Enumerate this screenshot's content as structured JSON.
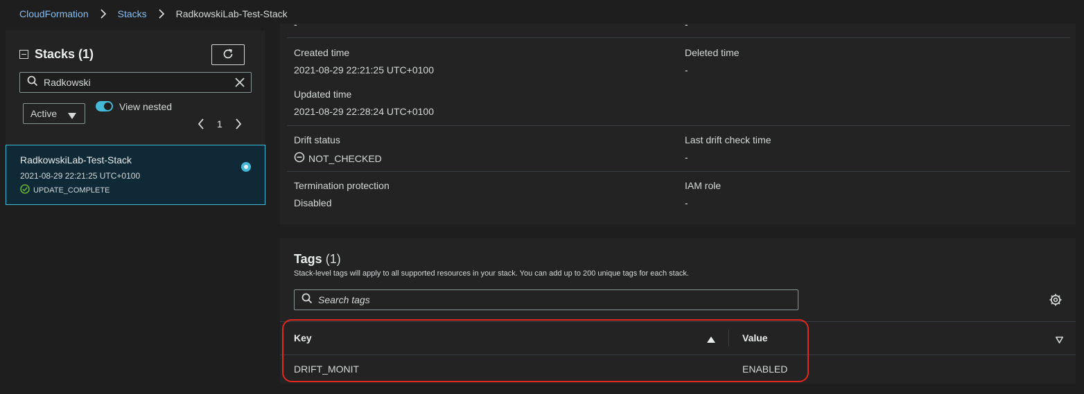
{
  "breadcrumb": {
    "items": [
      "CloudFormation",
      "Stacks"
    ],
    "current": "RadkowskiLab-Test-Stack"
  },
  "sidebar": {
    "title": "Stacks (1)",
    "search_value": "Radkowski",
    "status_filter": "Active",
    "view_nested_label": "View nested",
    "view_nested_on": true,
    "page": "1",
    "stack": {
      "name": "RadkowskiLab-Test-Stack",
      "date": "2021-08-29 22:21:25 UTC+0100",
      "status": "UPDATE_COMPLETE"
    }
  },
  "details": {
    "top_left_value": "-",
    "top_right_value": "-",
    "created_label": "Created time",
    "created_value": "2021-08-29 22:21:25 UTC+0100",
    "deleted_label": "Deleted time",
    "deleted_value": "-",
    "updated_label": "Updated time",
    "updated_value": "2021-08-29 22:28:24 UTC+0100",
    "drift_label": "Drift status",
    "drift_value": "NOT_CHECKED",
    "last_drift_label": "Last drift check time",
    "last_drift_value": "-",
    "termination_label": "Termination protection",
    "termination_value": "Disabled",
    "iam_label": "IAM role",
    "iam_value": "-"
  },
  "tags": {
    "title": "Tags",
    "count": "(1)",
    "description": "Stack-level tags will apply to all supported resources in your stack. You can add up to 200 unique tags for each stack.",
    "search_placeholder": "Search tags",
    "columns": {
      "key": "Key",
      "value": "Value"
    },
    "rows": [
      {
        "key": "DRIFT_MONIT",
        "value": "ENABLED"
      }
    ]
  },
  "colors": {
    "link": "#89bdee",
    "accent": "#44b9d6",
    "success": "#6aaf35",
    "highlight": "#e2271f"
  },
  "icons": [
    "chevron-right-icon",
    "collapse-icon",
    "refresh-icon",
    "search-icon",
    "close-icon",
    "caret-down-icon",
    "chevron-left-icon",
    "success-icon",
    "not-checked-icon",
    "settings-icon",
    "sort-asc-icon",
    "sort-desc-icon"
  ]
}
